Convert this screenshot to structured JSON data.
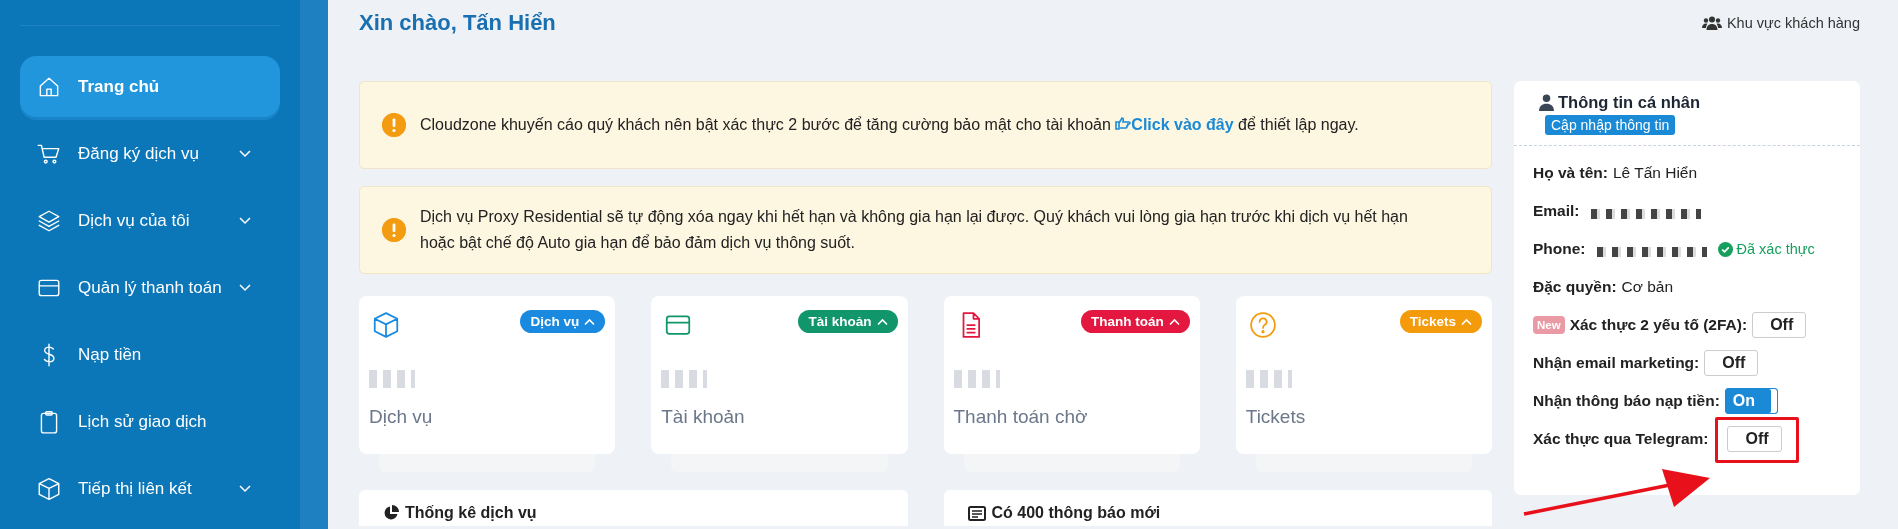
{
  "sidebar": {
    "items": [
      {
        "label": "Trang chủ",
        "selected": true,
        "has_submenu": false
      },
      {
        "label": "Đăng ký dịch vụ",
        "selected": false,
        "has_submenu": true
      },
      {
        "label": "Dịch vụ của tôi",
        "selected": false,
        "has_submenu": true
      },
      {
        "label": "Quản lý thanh toán",
        "selected": false,
        "has_submenu": true
      },
      {
        "label": "Nạp tiền",
        "selected": false,
        "has_submenu": false
      },
      {
        "label": "Lịch sử giao dịch",
        "selected": false,
        "has_submenu": false
      },
      {
        "label": "Tiếp thị liên kết",
        "selected": false,
        "has_submenu": true
      }
    ]
  },
  "header": {
    "greeting": "Xin chào, Tấn Hiển",
    "customer_area": "Khu vực khách hàng"
  },
  "alerts": [
    {
      "text": "Cloudzone khuyến cáo quý khách nên bật xác thực 2 bước để tăng cường bảo mật cho tài khoản",
      "link": "Click vào đây",
      "after": "để thiết lập ngay."
    },
    {
      "text": "Dịch vụ Proxy Residential sẽ tự động xóa ngay khi hết hạn và không gia hạn lại được. Quý khách vui lòng gia hạn trước khi dịch vụ hết hạn hoặc bật chế độ Auto gia hạn để bảo đảm dịch vụ thông suốt."
    }
  ],
  "stat_cards": [
    {
      "badge": "Dịch vụ",
      "color": "#1a8ae0",
      "caption": "Dịch vụ"
    },
    {
      "badge": "Tài khoản",
      "color": "#11966b",
      "caption": "Tài khoản"
    },
    {
      "badge": "Thanh toán",
      "color": "#e3173f",
      "caption": "Thanh toán chờ"
    },
    {
      "badge": "Tickets",
      "color": "#f49b0b",
      "caption": "Tickets"
    }
  ],
  "bottom_panels": [
    {
      "title": "Thống kê dịch vụ"
    },
    {
      "title": "Có 400 thông báo mới"
    }
  ],
  "profile": {
    "title": "Thông tin cá nhân",
    "update_button": "Cập nhập thông tin",
    "rows": [
      {
        "kind": "text",
        "label": "Họ và tên:",
        "value": "Lê Tấn Hiển"
      },
      {
        "kind": "hidden",
        "label": "Email:"
      },
      {
        "kind": "hidden",
        "label": "Phone:",
        "status": "Đã xác thực"
      },
      {
        "kind": "text",
        "label": "Đặc quyền:",
        "value": "Cơ bản"
      },
      {
        "kind": "toggle",
        "badge": "New",
        "label": "Xác thực 2 yếu tố (2FA):",
        "on": false,
        "state_text": "Off",
        "highlighted": false
      },
      {
        "kind": "toggle",
        "label": "Nhận email marketing:",
        "on": false,
        "state_text": "Off",
        "highlighted": false
      },
      {
        "kind": "toggle",
        "label": "Nhận thông báo nạp tiền:",
        "on": true,
        "state_text": "On",
        "highlighted": false
      },
      {
        "kind": "toggle",
        "label": "Xác thực qua Telegram:",
        "on": false,
        "state_text": "Off",
        "highlighted": true
      }
    ]
  }
}
